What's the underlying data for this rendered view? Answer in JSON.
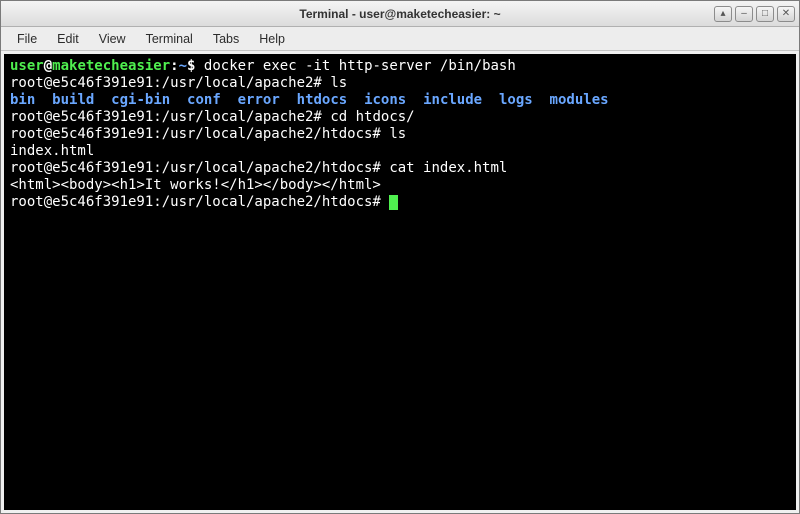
{
  "window": {
    "title": "Terminal - user@maketecheasier: ~"
  },
  "menubar": {
    "items": [
      "File",
      "Edit",
      "View",
      "Terminal",
      "Tabs",
      "Help"
    ]
  },
  "prompt": {
    "user": "user",
    "host": "maketecheasier",
    "path": "~",
    "sigil": "$"
  },
  "command1": "docker exec -it http-server /bin/bash",
  "container_prompt1": "root@e5c46f391e91:/usr/local/apache2#",
  "command2": "ls",
  "ls_output": {
    "dirs": [
      "bin",
      "build",
      "cgi-bin",
      "conf",
      "error",
      "htdocs",
      "icons",
      "include",
      "logs",
      "modules"
    ]
  },
  "container_prompt2": "root@e5c46f391e91:/usr/local/apache2#",
  "command3": "cd htdocs/",
  "container_prompt3": "root@e5c46f391e91:/usr/local/apache2/htdocs#",
  "command4": "ls",
  "ls_output2": "index.html",
  "container_prompt4": "root@e5c46f391e91:/usr/local/apache2/htdocs#",
  "command5": "cat index.html",
  "cat_output": "<html><body><h1>It works!</h1></body></html>",
  "container_prompt5": "root@e5c46f391e91:/usr/local/apache2/htdocs#",
  "icons": {
    "up": "▴",
    "minimize": "–",
    "maximize": "□",
    "close": "✕"
  }
}
